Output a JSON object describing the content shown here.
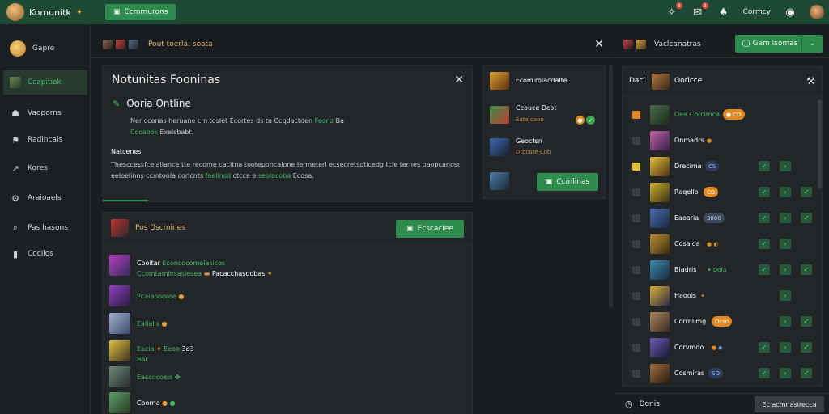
{
  "app": {
    "name": "Komunitk",
    "top_button": "Ccmmurons",
    "account_label": "Cormcy",
    "badges": {
      "notifications": "6",
      "messages": "3"
    }
  },
  "sidebar": {
    "items": [
      {
        "label": "Gapre",
        "icon": "game-avatar-icon",
        "active": false
      },
      {
        "label": "Ccapitiok",
        "icon": "thumbnail-icon",
        "active": true
      },
      {
        "label": "Vaoporns",
        "icon": "user-icon",
        "active": false
      },
      {
        "label": "Radincals",
        "icon": "flag-icon",
        "active": false
      },
      {
        "label": "Kores",
        "icon": "chart-icon",
        "active": false
      },
      {
        "label": "Araioaels",
        "icon": "gear-icon",
        "active": false
      },
      {
        "label": "Pas hasons",
        "icon": "search-icon",
        "active": false
      },
      {
        "label": "Cocilos",
        "icon": "info-icon",
        "active": false
      }
    ]
  },
  "middle": {
    "header_title": "Pout toerla: soata",
    "community": {
      "title": "Notunitas Fooninas",
      "online_label": "Ooria Ontline",
      "desc1_a": "Ner ccenas heruane cm toslet Ecortes ds ta Ccqdactden",
      "desc1_hl1": "Feonz",
      "desc1_b": "Ba",
      "desc1_hl2": "Cocabos",
      "desc1_c": "Exelsbabt.",
      "section_title": "Natcenes",
      "desc2_a": "Thesccessfce aliance tte recome cacitna tooteponcalone Iermeterl ecsecretsoticedg tcie ternes paopcanosr eeloelinns ccmtonla corlcnts",
      "desc2_hl1": "faelinsd",
      "desc2_b": "ctcca e",
      "desc2_hl2": "seolacoba",
      "desc2_c": "Ecosa."
    },
    "members": {
      "title": "Fcomirolacdalte",
      "list": [
        {
          "name": "Ccouce Dcot",
          "sub": "Sata caoo"
        },
        {
          "name": "Geoctsn",
          "sub": "Dtocate Cob"
        }
      ],
      "button": "Ccmlinas"
    },
    "feed": {
      "title": "Pos Dscmines",
      "button": "Ecscaciee",
      "items": [
        {
          "lead": "Cooitar",
          "green": "Econcocomelasicos",
          "line2_green": "Ccomtaminsasiesea",
          "line2_orange": "Pacacchasoobas"
        },
        {
          "lead": "",
          "green": "Pcaiaoooroe",
          "line2_green": "",
          "line2_orange": ""
        },
        {
          "lead": "",
          "green": "Ealialls",
          "line2_green": "",
          "line2_orange": ""
        },
        {
          "lead": "Eacia",
          "green": "Eeoo",
          "extra": "3d3",
          "line2_green": "Bar",
          "line2_orange": ""
        },
        {
          "lead": "",
          "green": "Eaccocoeis",
          "line2_green": "",
          "line2_orange": ""
        },
        {
          "lead": "Coorna",
          "green": "",
          "line2_green": "",
          "line2_orange": ""
        }
      ]
    }
  },
  "right": {
    "header_title": "Vaclcanatras",
    "header_button": "Gam Isomas",
    "list_title_a": "Dacl",
    "list_title_b": "Oorlcce",
    "rows": [
      {
        "name": "Oea Corcimca",
        "badge": "CO",
        "green": true
      },
      {
        "name": "Onmadrs",
        "badge": "",
        "green": false
      },
      {
        "name": "Drecima",
        "badge": "CS",
        "green": false
      },
      {
        "name": "Raqello",
        "badge": "CO",
        "green": false
      },
      {
        "name": "Eaoaria",
        "badge": "3800",
        "green": false
      },
      {
        "name": "Cosaida",
        "badge": "",
        "green": false
      },
      {
        "name": "Bladris",
        "badge": "Dofa",
        "green": false
      },
      {
        "name": "Haoois",
        "badge": "",
        "green": false
      },
      {
        "name": "Corrnlimg",
        "badge": "Dcso",
        "green": false
      },
      {
        "name": "Corvmdo",
        "badge": "",
        "green": false
      },
      {
        "name": "Cosmiras",
        "badge": "SO",
        "green": false
      }
    ],
    "bottom_label": "Donis",
    "bottom_button": "Ec acmnasirecca"
  },
  "colors": {
    "accent": "#2f8a4e",
    "topbar": "#1e4a35",
    "background": "#1a1d20",
    "highlight_green": "#46b865",
    "highlight_orange": "#e0a040"
  }
}
